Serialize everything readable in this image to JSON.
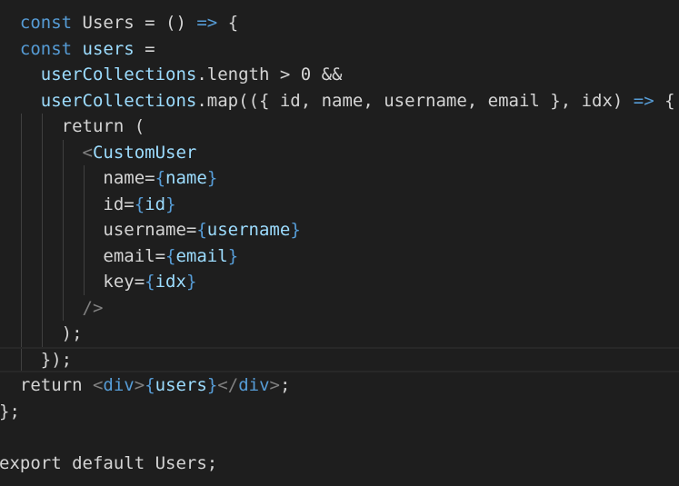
{
  "editor": {
    "colors": {
      "background": "#1e1e1e",
      "keyword": "#569cd6",
      "default": "#d4d4d4",
      "variable": "#9cdcfe",
      "component": "#4ec9b0",
      "bracket_punct": "#808080",
      "indent_guide": "#404040"
    },
    "current_line": 13,
    "lines": [
      {
        "indent": 2,
        "tokens": [
          {
            "t": "keyword",
            "v": "const"
          },
          {
            "t": "default",
            "v": " Users = () "
          },
          {
            "t": "keyword",
            "v": "=>"
          },
          {
            "t": "default",
            "v": " {"
          }
        ]
      },
      {
        "indent": 2,
        "tokens": [
          {
            "t": "keyword",
            "v": "const"
          },
          {
            "t": "default",
            "v": " "
          },
          {
            "t": "var",
            "v": "users"
          },
          {
            "t": "default",
            "v": " ="
          }
        ]
      },
      {
        "indent": 4,
        "tokens": [
          {
            "t": "var",
            "v": "userCollections"
          },
          {
            "t": "default",
            "v": ".length > 0 &&"
          }
        ]
      },
      {
        "indent": 4,
        "tokens": [
          {
            "t": "var",
            "v": "userCollections"
          },
          {
            "t": "default",
            "v": ".map(({ id, name, username, email }, idx) "
          },
          {
            "t": "keyword",
            "v": "=>"
          },
          {
            "t": "default",
            "v": " {"
          }
        ]
      },
      {
        "indent": 6,
        "tokens": [
          {
            "t": "default",
            "v": "return ("
          }
        ]
      },
      {
        "indent": 8,
        "tokens": [
          {
            "t": "punct",
            "v": "<"
          },
          {
            "t": "var",
            "v": "CustomUser"
          }
        ]
      },
      {
        "indent": 10,
        "tokens": [
          {
            "t": "default",
            "v": "name="
          },
          {
            "t": "keyword",
            "v": "{"
          },
          {
            "t": "var",
            "v": "name"
          },
          {
            "t": "keyword",
            "v": "}"
          }
        ]
      },
      {
        "indent": 10,
        "tokens": [
          {
            "t": "default",
            "v": "id="
          },
          {
            "t": "keyword",
            "v": "{"
          },
          {
            "t": "var",
            "v": "id"
          },
          {
            "t": "keyword",
            "v": "}"
          }
        ]
      },
      {
        "indent": 10,
        "tokens": [
          {
            "t": "default",
            "v": "username="
          },
          {
            "t": "keyword",
            "v": "{"
          },
          {
            "t": "var",
            "v": "username"
          },
          {
            "t": "keyword",
            "v": "}"
          }
        ]
      },
      {
        "indent": 10,
        "tokens": [
          {
            "t": "default",
            "v": "email="
          },
          {
            "t": "keyword",
            "v": "{"
          },
          {
            "t": "var",
            "v": "email"
          },
          {
            "t": "keyword",
            "v": "}"
          }
        ]
      },
      {
        "indent": 10,
        "tokens": [
          {
            "t": "default",
            "v": "key="
          },
          {
            "t": "keyword",
            "v": "{"
          },
          {
            "t": "var",
            "v": "idx"
          },
          {
            "t": "keyword",
            "v": "}"
          }
        ]
      },
      {
        "indent": 8,
        "tokens": [
          {
            "t": "punct",
            "v": "/>"
          }
        ]
      },
      {
        "indent": 6,
        "tokens": [
          {
            "t": "default",
            "v": ");"
          }
        ]
      },
      {
        "indent": 4,
        "tokens": [
          {
            "t": "default",
            "v": "});"
          }
        ]
      },
      {
        "indent": 2,
        "tokens": [
          {
            "t": "default",
            "v": "return "
          },
          {
            "t": "punct",
            "v": "<"
          },
          {
            "t": "keyword",
            "v": "div"
          },
          {
            "t": "punct",
            "v": ">"
          },
          {
            "t": "keyword",
            "v": "{"
          },
          {
            "t": "var",
            "v": "users"
          },
          {
            "t": "keyword",
            "v": "}"
          },
          {
            "t": "punct",
            "v": "</"
          },
          {
            "t": "keyword",
            "v": "div"
          },
          {
            "t": "punct",
            "v": ">"
          },
          {
            "t": "default",
            "v": ";"
          }
        ]
      },
      {
        "indent": 0,
        "tokens": [
          {
            "t": "default",
            "v": "};"
          }
        ]
      },
      {
        "indent": 0,
        "tokens": []
      },
      {
        "indent": 0,
        "tokens": [
          {
            "t": "default",
            "v": "export default Users;"
          }
        ]
      }
    ]
  }
}
